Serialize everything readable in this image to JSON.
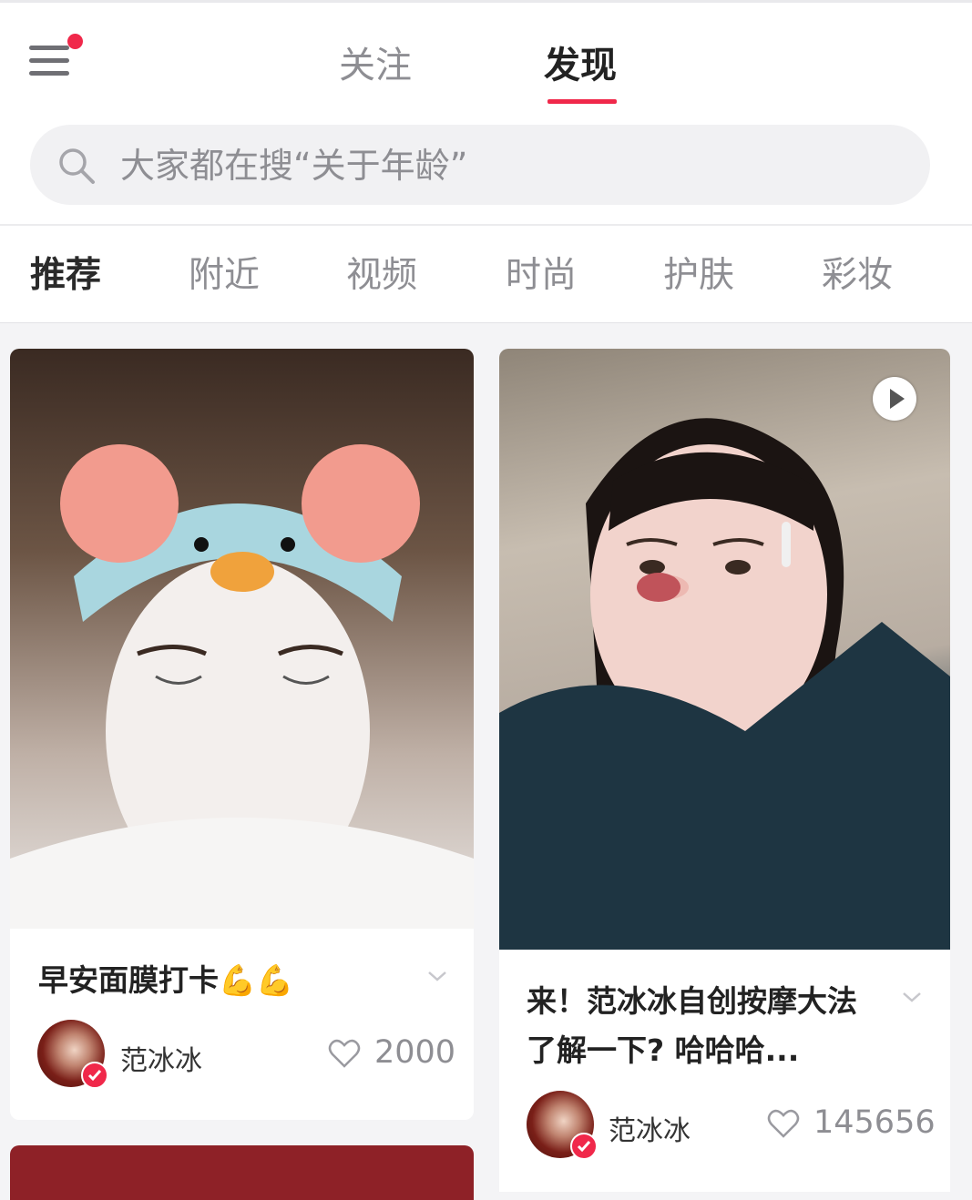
{
  "nav": {
    "follow_label": "关注",
    "discover_label": "发现",
    "active_tab": "发现",
    "has_notification": true
  },
  "search": {
    "placeholder": "大家都在搜“关于年龄”"
  },
  "categories": [
    {
      "label": "推荐",
      "active": true
    },
    {
      "label": "附近",
      "active": false
    },
    {
      "label": "视频",
      "active": false
    },
    {
      "label": "时尚",
      "active": false
    },
    {
      "label": "护肤",
      "active": false
    },
    {
      "label": "彩妆",
      "active": false
    }
  ],
  "feed": [
    {
      "title": "早安面膜打卡💪💪",
      "author": "范冰冰",
      "likes": "2000",
      "is_video": false,
      "photo_desc_icon": "photo"
    },
    {
      "title": "来！范冰冰自创按摩大法了解一下? 哈哈哈...",
      "author": "范冰冰",
      "likes": "145656",
      "is_video": true,
      "photo_desc_icon": "video"
    }
  ],
  "colors": {
    "accent": "#f0284a",
    "inactive_text": "#8e8e93",
    "active_text": "#222222",
    "background": "#f4f4f6"
  },
  "icons": {
    "menu": "hamburger-icon",
    "search": "search-icon",
    "like": "heart-outline-icon",
    "more": "chevron-down-icon",
    "play": "play-icon",
    "verified": "verified-check-icon"
  }
}
